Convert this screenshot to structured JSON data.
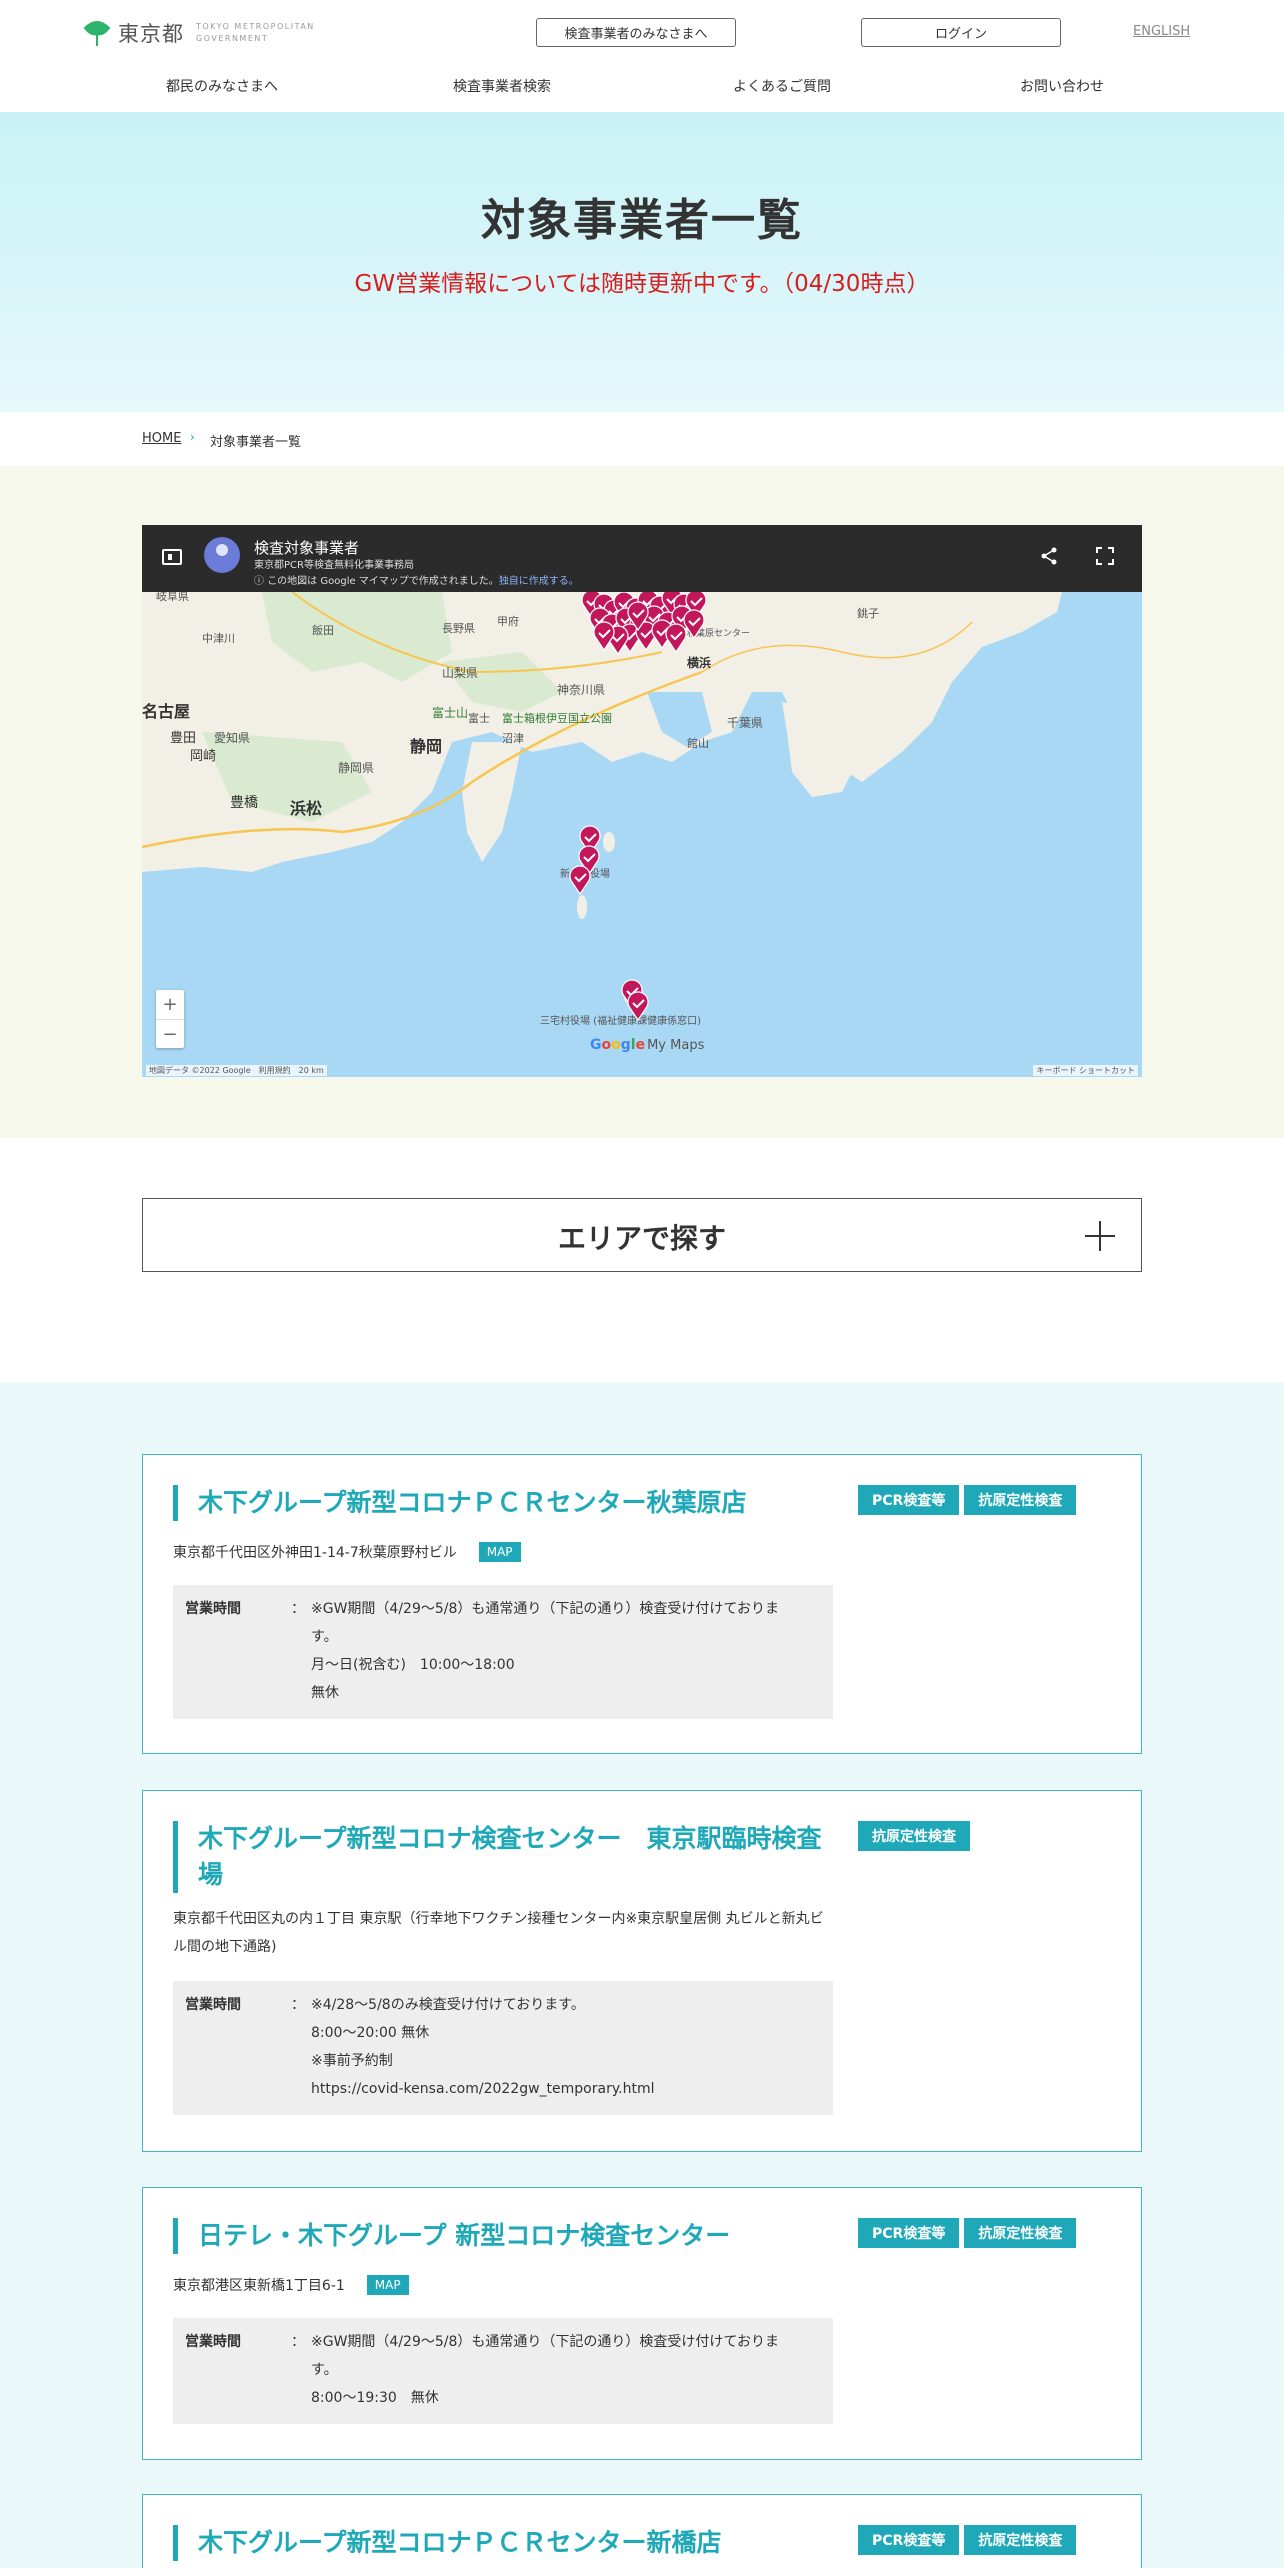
{
  "header": {
    "logo_name": "東京都",
    "logo_sub": "TOKYO METROPOLITAN GOVERNMENT",
    "biz_button": "検査事業者のみなさまへ",
    "login_button": "ログイン",
    "english_link": "ENGLISH",
    "nav": [
      "都民のみなさまへ",
      "検査事業者検索",
      "よくあるご質問",
      "お問い合わせ"
    ]
  },
  "hero": {
    "title": "対象事業者一覧",
    "notice": "GW営業情報については随時更新中です。（04/30時点）"
  },
  "breadcrumb": {
    "home": "HOME",
    "separator": "›",
    "current": "対象事業者一覧"
  },
  "map": {
    "title": "検査対象事業者",
    "subtitle": "東京都PCR等検査無料化事業事務局",
    "made_with": "この地図は Google マイマップで作成されました。",
    "create_link": "独自に作成する。",
    "zoom_in": "+",
    "zoom_out": "−",
    "footer_left": "地図データ ©2022 Google　利用規約　20 km",
    "footer_right": "キーボード ショートカット",
    "brand_mymaps": "My Maps",
    "labels": {
      "gifu": "岐阜県",
      "nagano": "長野県",
      "yamanashi": "山梨県",
      "kanagawa": "神奈川県",
      "chiba": "千葉県",
      "aichi": "愛知県",
      "shizuoka_pref": "静岡県",
      "nagoya": "名古屋",
      "toyota": "豊田",
      "okazaki": "岡崎",
      "toyohashi": "豊橋",
      "hamamatsu": "浜松",
      "shizuoka": "静岡",
      "fuji": "富士",
      "numazu": "沼津",
      "mtfuji": "富士山",
      "park": "富士箱根伊豆国立公園",
      "tateyama": "館山",
      "choshi": "銚子",
      "kofu": "甲府",
      "iida": "飯田",
      "nakatsugawa": "中津川",
      "yokohama": "横浜",
      "akihabara": "秋葉原センター",
      "niijima": "新島村役場",
      "miyake": "三宅村役場 (福祉健康課健康係窓口)"
    }
  },
  "area": {
    "label": "エリアで探す"
  },
  "cards": [
    {
      "title": "木下グループ新型コロナＰＣＲセンター秋葉原店",
      "tags": [
        "PCR検査等",
        "抗原定性検査"
      ],
      "address": "東京都千代田区外神田1-14-7秋葉原野村ビル",
      "map_button": "MAP",
      "hours_label": "営業時間",
      "colon": "：",
      "hours": [
        "※GW期間（4/29～5/8）も通常通り（下記の通り）検査受け付けておりま",
        "す。",
        "月～日(祝含む)　10:00～18:00",
        "無休"
      ]
    },
    {
      "title": "木下グループ新型コロナ検査センター　東京駅臨時検査場",
      "tags": [
        "抗原定性検査"
      ],
      "address": "東京都千代田区丸の内１丁目 東京駅（行幸地下ワクチン接種センター内※東京駅皇居側 丸ビルと新丸ビル間の地下通路)",
      "hours_label": "営業時間",
      "colon": "：",
      "hours": [
        "※4/28～5/8のみ検査受け付けております。",
        "8:00～20:00 無休",
        "※事前予約制",
        "https://covid-kensa.com/2022gw_temporary.html"
      ]
    },
    {
      "title": "日テレ・木下グループ 新型コロナ検査センター",
      "tags": [
        "PCR検査等",
        "抗原定性検査"
      ],
      "address": "東京都港区東新橋1丁目6-1",
      "map_button": "MAP",
      "hours_label": "営業時間",
      "colon": "：",
      "hours": [
        "※GW期間（4/29～5/8）も通常通り（下記の通り）検査受け付けておりま",
        "す。",
        "8:00～19:30　無休"
      ]
    },
    {
      "title": "木下グループ新型コロナＰＣＲセンター新橋店",
      "tags": [
        "PCR検査等",
        "抗原定性検査"
      ]
    }
  ],
  "colors": {
    "accent": "#1fa9b8",
    "notice": "#d71d1d",
    "pin": "#c2185b",
    "sea": "#a9d8f5",
    "land": "#f2efe6"
  }
}
